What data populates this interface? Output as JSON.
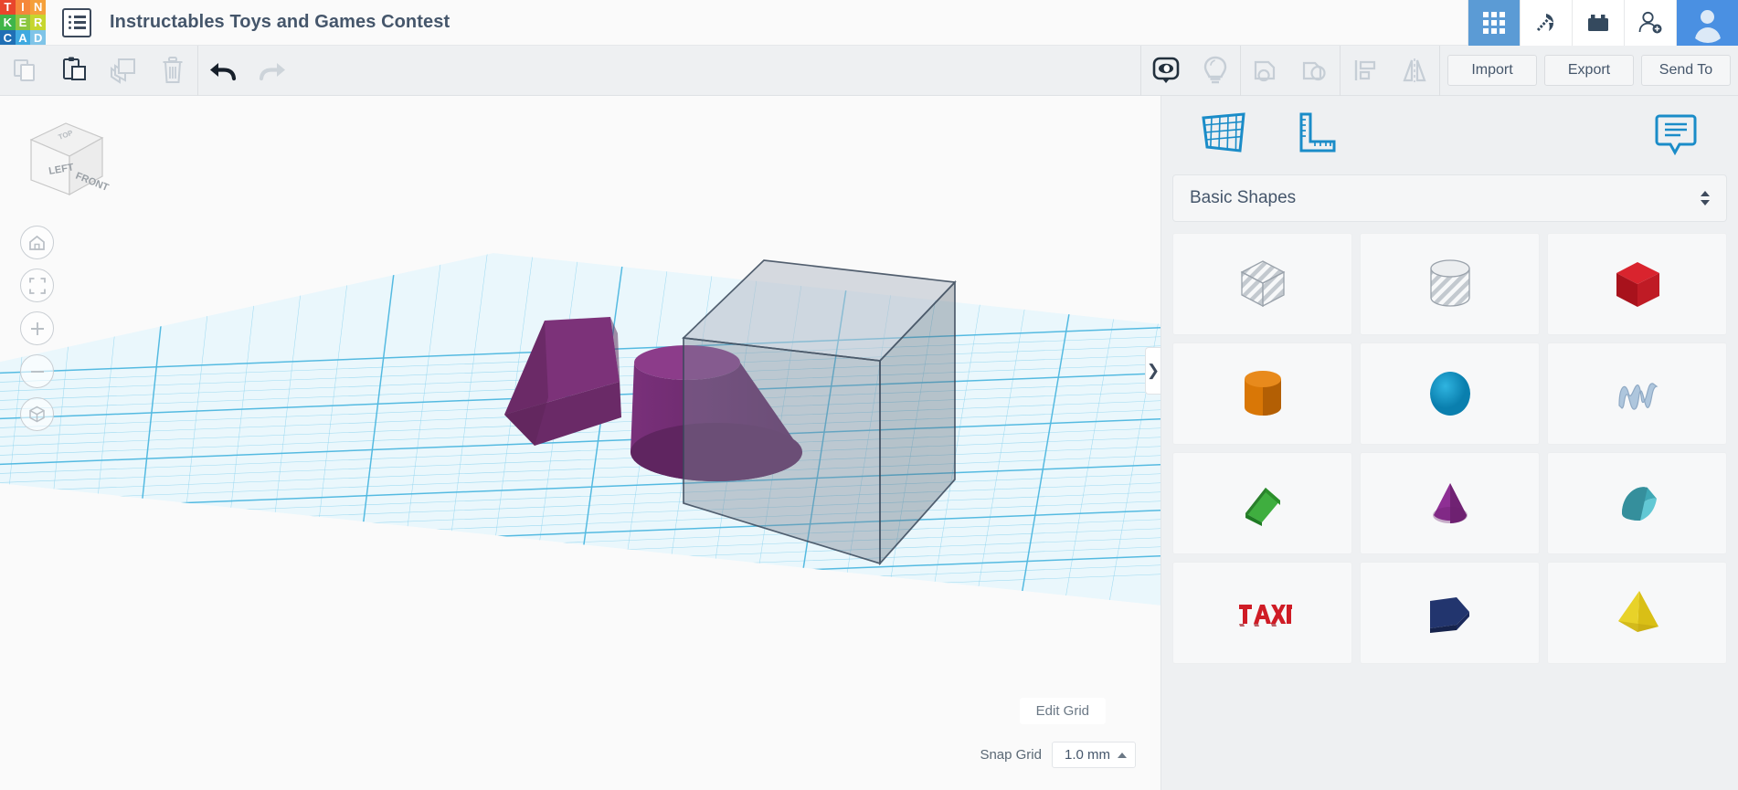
{
  "app": {
    "name": "Tinkercad",
    "logo_letters": [
      {
        "ch": "T",
        "color": "#e8452c"
      },
      {
        "ch": "I",
        "color": "#f5873a"
      },
      {
        "ch": "N",
        "color": "#f5a03a"
      },
      {
        "ch": "K",
        "color": "#3fb54a"
      },
      {
        "ch": "E",
        "color": "#8bc63f"
      },
      {
        "ch": "R",
        "color": "#c6d62e"
      },
      {
        "ch": "C",
        "color": "#1f6fb5"
      },
      {
        "ch": "A",
        "color": "#3fa9e0"
      },
      {
        "ch": "D",
        "color": "#7fc4e8"
      }
    ]
  },
  "header": {
    "menu_icon": "list-menu-icon",
    "title": "Instructables Toys and Games Contest",
    "right_buttons": [
      {
        "name": "apps-grid-button",
        "icon": "grid-9-icon",
        "active": true
      },
      {
        "name": "codeblocks-button",
        "icon": "pickaxe-icon",
        "active": false
      },
      {
        "name": "blocks-button",
        "icon": "brick-icon",
        "active": false
      },
      {
        "name": "invite-button",
        "icon": "user-add-icon",
        "active": false
      }
    ],
    "avatar": "user-avatar"
  },
  "toolbar": {
    "left_buttons": [
      {
        "name": "copy-button",
        "icon": "copy-icon",
        "label": "Copy",
        "enabled": false
      },
      {
        "name": "paste-button",
        "icon": "clipboard-paste-icon",
        "label": "Paste",
        "enabled": true
      },
      {
        "name": "duplicate-button",
        "icon": "duplicate-icon",
        "label": "Duplicate",
        "enabled": false
      },
      {
        "name": "delete-button",
        "icon": "trash-icon",
        "label": "Delete",
        "enabled": false
      }
    ],
    "history_buttons": [
      {
        "name": "undo-button",
        "icon": "undo-arrow-icon",
        "label": "Undo",
        "enabled": true
      },
      {
        "name": "redo-button",
        "icon": "redo-arrow-icon",
        "label": "Redo",
        "enabled": false
      }
    ],
    "view_buttons": [
      {
        "name": "show-hide-button",
        "icon": "eye-mask-icon",
        "label": "Show/Hide",
        "enabled": true
      },
      {
        "name": "highlight-button",
        "icon": "lightbulb-icon",
        "label": "Highlight",
        "enabled": false
      }
    ],
    "group_buttons": [
      {
        "name": "group-button",
        "icon": "group-shapes-icon",
        "label": "Group",
        "enabled": false
      },
      {
        "name": "ungroup-button",
        "icon": "ungroup-shapes-icon",
        "label": "Ungroup",
        "enabled": false
      }
    ],
    "align_buttons": [
      {
        "name": "align-button",
        "icon": "align-icon",
        "label": "Align",
        "enabled": false
      },
      {
        "name": "mirror-button",
        "icon": "mirror-flip-icon",
        "label": "Mirror",
        "enabled": false
      }
    ],
    "import_label": "Import",
    "export_label": "Export",
    "send_to_label": "Send To"
  },
  "canvas": {
    "viewcube": {
      "name": "view-cube",
      "top_face": "TOP",
      "left_face": "LEFT",
      "front_face": "FRONT"
    },
    "nav_buttons": [
      {
        "name": "home-view-button",
        "icon": "home-icon"
      },
      {
        "name": "fit-to-view-button",
        "icon": "fit-frame-icon"
      },
      {
        "name": "zoom-in-button",
        "icon": "plus-icon"
      },
      {
        "name": "zoom-out-button",
        "icon": "minus-icon"
      },
      {
        "name": "ortho-perspective-button",
        "icon": "cube-view-icon"
      }
    ],
    "panel_toggle_icon": "chevron-right-icon",
    "edit_grid_label": "Edit Grid",
    "snap_grid_label": "Snap Grid",
    "snap_grid_value": "1.0 mm",
    "objects": [
      {
        "name": "wedge-shape",
        "color": "#6e2d6b"
      },
      {
        "name": "cone-shape",
        "color": "#7a2f78"
      },
      {
        "name": "box-hole-shape",
        "color": "#8d99a8"
      }
    ],
    "grid_color": "#6fc5e8",
    "plane_color": "#eaf7fc"
  },
  "right_panel": {
    "tool_icons": [
      {
        "name": "workplane-button",
        "icon": "workplane-grid-icon"
      },
      {
        "name": "ruler-button",
        "icon": "ruler-icon"
      },
      {
        "name": "note-button",
        "icon": "note-bubble-icon"
      }
    ],
    "accent_color": "#1a8cc8",
    "category_label": "Basic Shapes",
    "shapes": [
      {
        "name": "shape-box-hole",
        "label": "Box Hole",
        "icon": "striped-box-icon"
      },
      {
        "name": "shape-cylinder-hole",
        "label": "Cylinder Hole",
        "icon": "striped-cylinder-icon"
      },
      {
        "name": "shape-box",
        "label": "Box",
        "icon": "red-box-icon"
      },
      {
        "name": "shape-cylinder",
        "label": "Cylinder",
        "icon": "orange-cylinder-icon"
      },
      {
        "name": "shape-sphere",
        "label": "Sphere",
        "icon": "blue-sphere-icon"
      },
      {
        "name": "shape-scribble",
        "label": "Scribble",
        "icon": "scribble-icon"
      },
      {
        "name": "shape-roof",
        "label": "Roof",
        "icon": "green-roof-icon"
      },
      {
        "name": "shape-cone",
        "label": "Cone",
        "icon": "purple-cone-icon"
      },
      {
        "name": "shape-round-roof",
        "label": "Round Roof",
        "icon": "teal-round-roof-icon"
      },
      {
        "name": "shape-text",
        "label": "Text",
        "icon": "red-text-icon"
      },
      {
        "name": "shape-polygon",
        "label": "Polygon",
        "icon": "navy-polygon-icon"
      },
      {
        "name": "shape-pyramid",
        "label": "Pyramid",
        "icon": "yellow-pyramid-icon"
      }
    ]
  }
}
